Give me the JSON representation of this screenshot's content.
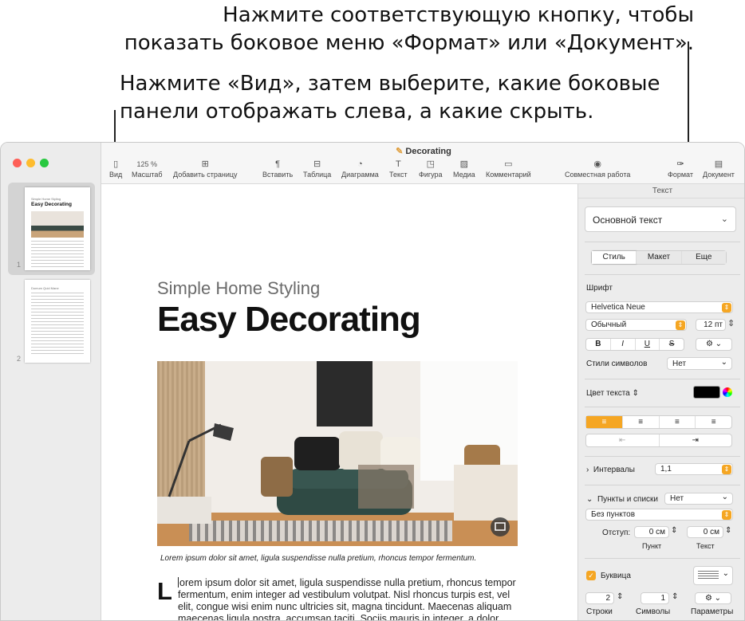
{
  "callouts": {
    "format_doc": "Нажмите соответствующую кнопку, чтобы показать боковое меню «Формат» или «Документ».",
    "view": "Нажмите «Вид», затем выберите, какие боковые панели отображать слева, а какие скрыть."
  },
  "window": {
    "title": "Decorating"
  },
  "sidebar": {
    "pages": [
      {
        "number": "1",
        "subtitle": "Simple Home Styling",
        "title": "Easy Decorating"
      },
      {
        "number": "2",
        "title": "Domum Quid Mane"
      }
    ]
  },
  "toolbar": {
    "view": "Вид",
    "zoom_value": "125 %",
    "zoom": "Масштаб",
    "add_page": "Добавить страницу",
    "insert": "Вставить",
    "table": "Таблица",
    "chart": "Диаграмма",
    "text": "Текст",
    "shape": "Фигура",
    "media": "Медиа",
    "comment": "Комментарий",
    "collaborate": "Совместная работа",
    "format": "Формат",
    "document": "Документ"
  },
  "document": {
    "subtitle": "Simple Home Styling",
    "title": "Easy Decorating",
    "caption": "Lorem ipsum dolor sit amet, ligula suspendisse nulla pretium, rhoncus tempor fermentum.",
    "dropcap": "L",
    "body": "orem ipsum dolor sit amet, ligula suspendisse nulla pretium, rhoncus tempor fermentum, enim integer ad vestibulum volutpat. Nisl rhoncus turpis est, vel elit, congue wisi enim nunc ultricies sit, magna tincidunt. Maecenas aliquam maecenas ligula nostra, accumsan taciti. Sociis mauris in integer, a dolor netus"
  },
  "panel": {
    "header": "Текст",
    "paragraph_style": "Основной текст",
    "tabs": [
      "Стиль",
      "Макет",
      "Еще"
    ],
    "font_label": "Шрифт",
    "font_name": "Helvetica Neue",
    "font_face": "Обычный",
    "font_size": "12 пт",
    "style_buttons": [
      "B",
      "I",
      "U",
      "S"
    ],
    "char_styles_label": "Стили символов",
    "char_styles_value": "Нет",
    "text_color_label": "Цвет текста",
    "text_color": "#000000",
    "spacing_label": "Интервалы",
    "spacing_value": "1,1",
    "bullets_label": "Пункты и списки",
    "bullets_value": "Нет",
    "bullets_type": "Без пунктов",
    "indent_label": "Отступ:",
    "indent_bullet_value": "0 см",
    "indent_text_value": "0 см",
    "indent_bullet_label": "Пункт",
    "indent_text_label": "Текст",
    "dropcap_label": "Буквица",
    "lines_value": "2",
    "chars_value": "1",
    "lines_label": "Строки",
    "chars_label": "Символы",
    "params_label": "Параметры"
  }
}
